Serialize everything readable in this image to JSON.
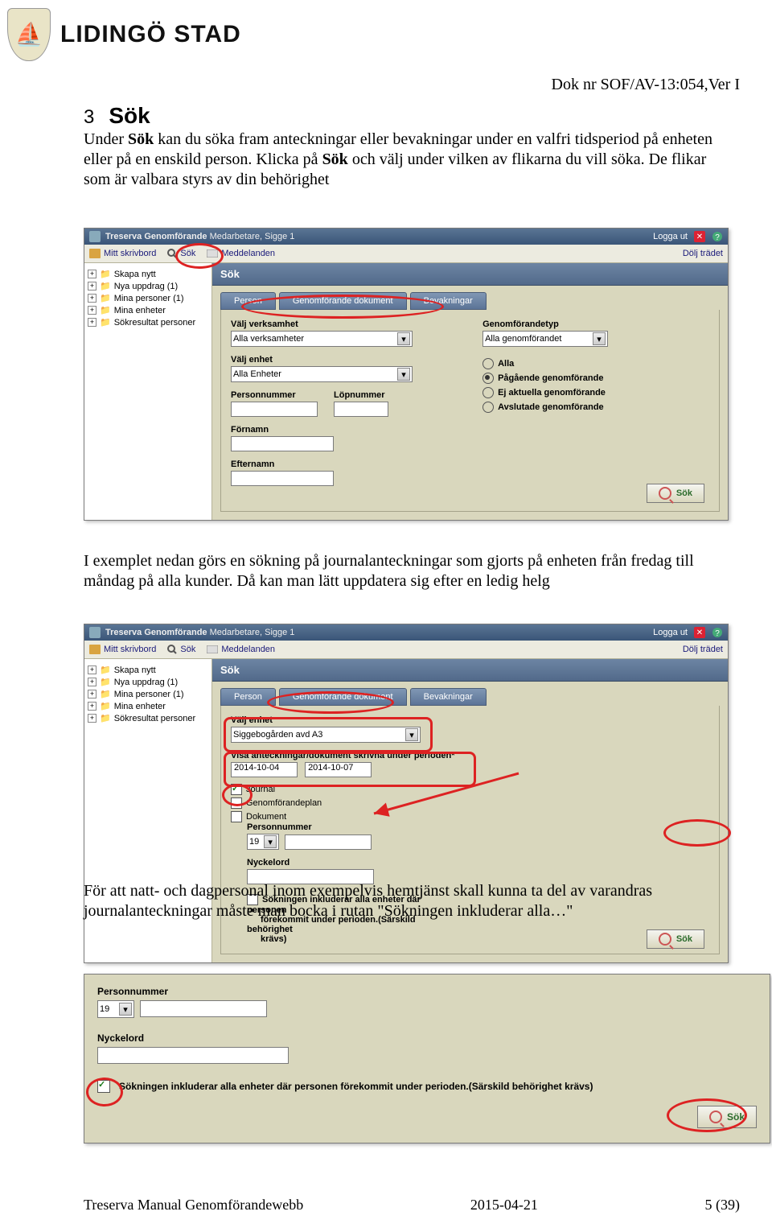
{
  "logo_brand": "LIDINGÖ STAD",
  "logo_emoji": "⛵",
  "doc_nr": "Dok nr SOF/AV-13:054,Ver I",
  "section_number": "3",
  "section_title": "Sök",
  "para1_part1": "Under ",
  "para1_b1": "Sök",
  "para1_part2": " kan du söka fram anteckningar eller bevakningar under en valfri tidsperiod på enheten eller på en enskild person. Klicka på ",
  "para1_b2": "Sök",
  "para1_part3": " och välj under vilken av flikarna du vill söka. De flikar som är valbara styrs av din behörighet",
  "para2": "I exemplet nedan görs en sökning på journalanteckningar som gjorts på enheten från fredag till måndag på alla kunder. Då kan man lätt uppdatera sig efter en ledig helg",
  "para3": "För att natt- och dagpersonal inom exempelvis hemtjänst skall kunna ta del av varandras journalanteckningar måste man bocka i rutan \"Sökningen inkluderar alla…\"",
  "app": {
    "title_app": "Treserva Genomförande",
    "title_user": "Medarbetare, Sigge 1",
    "logga_ut": "Logga ut",
    "hide_tree": "Dölj trädet",
    "menu": {
      "skrivbord": "Mitt skrivbord",
      "sok": "Sök",
      "meddelanden": "Meddelanden"
    },
    "tree": {
      "skapa": "Skapa nytt",
      "nya": "Nya uppdrag (1)",
      "mina_p": "Mina personer (1)",
      "mina_e": "Mina enheter",
      "sokres": "Sökresultat personer"
    },
    "content_title": "Sök",
    "tabs": {
      "person": "Person",
      "dok": "Genomförande dokument",
      "bevak": "Bevakningar"
    },
    "sokbtn": "Sök"
  },
  "app1": {
    "valj_verksamhet_lbl": "Välj verksamhet",
    "valj_verksamhet_val": "Alla verksamheter",
    "valj_enhet_lbl": "Välj enhet",
    "valj_enhet_val": "Alla Enheter",
    "personnummer_lbl": "Personnummer",
    "lopnr_lbl": "Löpnummer",
    "fornamn_lbl": "Förnamn",
    "efternamn_lbl": "Efternamn",
    "typ_lbl": "Genomförandetyp",
    "typ_val": "Alla genomförandet",
    "r_alla": "Alla",
    "r_pag": "Pågående genomförande",
    "r_ej": "Ej aktuella genomförande",
    "r_avs": "Avslutade genomförande"
  },
  "app2": {
    "valj_enhet_lbl": "Välj enhet",
    "valj_enhet_val": "Siggebogården avd A3",
    "visa_lbl": "Visa anteckningar/dokument skrivna under perioden*",
    "date_from": "2014-10-04",
    "date_to": "2014-10-07",
    "cb_journal": "Journal",
    "cb_plan": "Genomförandeplan",
    "cb_dok": "Dokument",
    "personnummer_lbl": "Personnummer",
    "pnr_prefix": "19",
    "nyckelord_lbl": "Nyckelord",
    "inkluderar1": "Sökningen inkluderar alla enheter där personen",
    "inkluderar2": "förekommit under perioden.(Särskild behörighet",
    "inkluderar3": "krävs)"
  },
  "snip3": {
    "pnr_lbl": "Personnummer",
    "pnr_prefix": "19",
    "nyckelord_lbl": "Nyckelord",
    "inkluderar": "Sökningen inkluderar alla enheter där personen förekommit under perioden.(Särskild behörighet krävs)",
    "sok": "Sök"
  },
  "footer": {
    "left": "Treserva Manual Genomförandewebb",
    "center": "2015-04-21",
    "right": "5 (39)"
  }
}
